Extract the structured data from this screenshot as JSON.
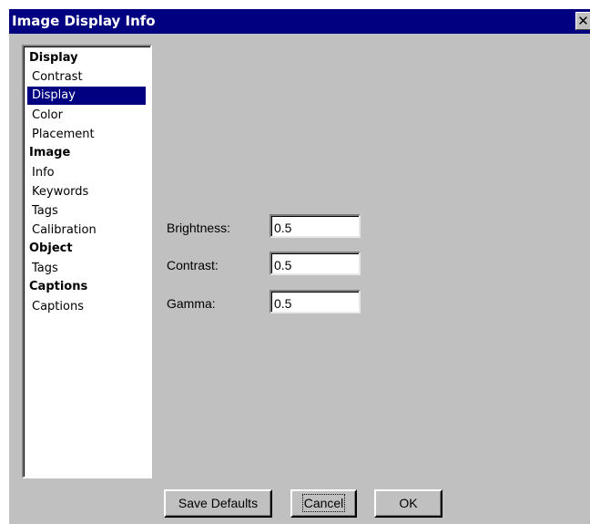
{
  "window": {
    "title": "Image Display Info",
    "close_glyph": "✕"
  },
  "nav": {
    "items": [
      {
        "label": "Display",
        "kind": "header"
      },
      {
        "label": "Contrast",
        "kind": "item"
      },
      {
        "label": "Display",
        "kind": "item",
        "selected": true
      },
      {
        "label": "Color",
        "kind": "item"
      },
      {
        "label": "Placement",
        "kind": "item"
      },
      {
        "label": "Image",
        "kind": "header"
      },
      {
        "label": "Info",
        "kind": "item"
      },
      {
        "label": "Keywords",
        "kind": "item"
      },
      {
        "label": "Tags",
        "kind": "item"
      },
      {
        "label": "Calibration",
        "kind": "item"
      },
      {
        "label": "Object",
        "kind": "header"
      },
      {
        "label": "Tags",
        "kind": "item"
      },
      {
        "label": "Captions",
        "kind": "header"
      },
      {
        "label": "Captions",
        "kind": "item"
      }
    ]
  },
  "form": {
    "brightness_label": "Brightness:",
    "brightness_value": "0.5",
    "contrast_label": "Contrast:",
    "contrast_value": "0.5",
    "gamma_label": "Gamma:",
    "gamma_value": "0.5"
  },
  "buttons": {
    "save_defaults": "Save Defaults",
    "cancel": "Cancel",
    "ok": "OK"
  },
  "colors": {
    "titlebar": "#000080",
    "face": "#c0c0c0",
    "selection": "#000080"
  }
}
